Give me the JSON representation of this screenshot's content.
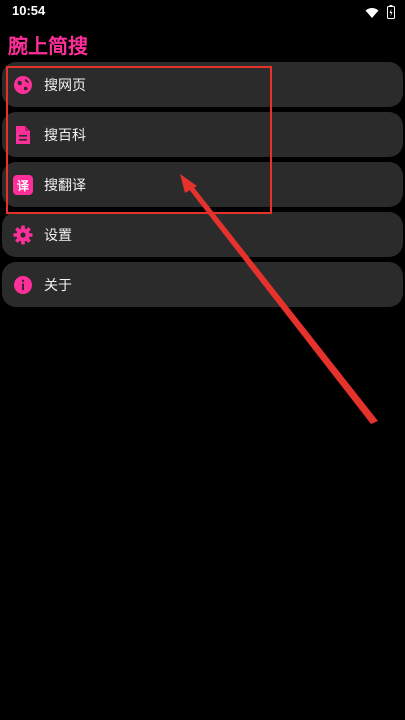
{
  "status_bar": {
    "time": "10:54"
  },
  "app": {
    "title": "腕上简搜"
  },
  "menu": {
    "items": [
      {
        "label": "搜网页",
        "icon": "globe-icon"
      },
      {
        "label": "搜百科",
        "icon": "document-icon"
      },
      {
        "label": "搜翻译",
        "icon": "translate-icon",
        "badge": "译"
      },
      {
        "label": "设置",
        "icon": "gear-icon"
      },
      {
        "label": "关于",
        "icon": "info-icon"
      }
    ]
  },
  "colors": {
    "accent": "#ff2f9a",
    "item_background": "#2b2b2b",
    "annotation_red": "#e5322d",
    "background": "#000000"
  }
}
